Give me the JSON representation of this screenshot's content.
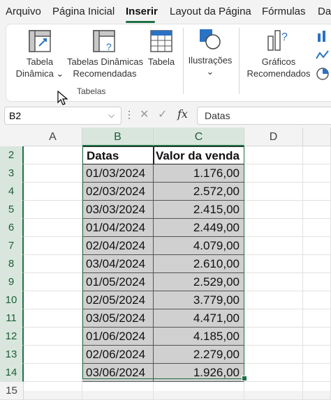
{
  "menu": {
    "items": [
      "Arquivo",
      "Página Inicial",
      "Inserir",
      "Layout da Página",
      "Fórmulas",
      "Da"
    ],
    "active": "Inserir"
  },
  "ribbon": {
    "tabela_dinamica": [
      "Tabela",
      "Dinâmica ⌄"
    ],
    "tabelas_recomendadas": [
      "Tabelas Dinâmicas",
      "Recomendadas"
    ],
    "tabela": "Tabela",
    "group_label": "Tabelas",
    "ilustracoes": "Ilustrações",
    "ilustracoes_chevron": "⌄",
    "graficos": [
      "Gráficos",
      "Recomendados"
    ]
  },
  "formula_bar": {
    "namebox": "B2",
    "content": "Datas"
  },
  "sheet": {
    "columns": [
      "A",
      "B",
      "C",
      "D"
    ],
    "rows": [
      "2",
      "3",
      "4",
      "5",
      "6",
      "7",
      "8",
      "9",
      "10",
      "11",
      "12",
      "13",
      "14",
      "15"
    ],
    "header": [
      "Datas",
      "Valor da venda"
    ],
    "data": [
      [
        "01/03/2024",
        "1.176,00"
      ],
      [
        "02/03/2024",
        "2.572,00"
      ],
      [
        "03/03/2024",
        "2.415,00"
      ],
      [
        "01/04/2024",
        "2.449,00"
      ],
      [
        "02/04/2024",
        "4.079,00"
      ],
      [
        "03/04/2024",
        "2.610,00"
      ],
      [
        "01/05/2024",
        "2.529,00"
      ],
      [
        "02/05/2024",
        "3.779,00"
      ],
      [
        "03/05/2024",
        "4.471,00"
      ],
      [
        "01/06/2024",
        "4.185,00"
      ],
      [
        "02/06/2024",
        "2.279,00"
      ],
      [
        "03/06/2024",
        "1.926,00"
      ]
    ]
  },
  "colors": {
    "accent": "#1e7145",
    "selected_header": "#d9e6dd",
    "cell_fill": "#d0d0d0"
  }
}
